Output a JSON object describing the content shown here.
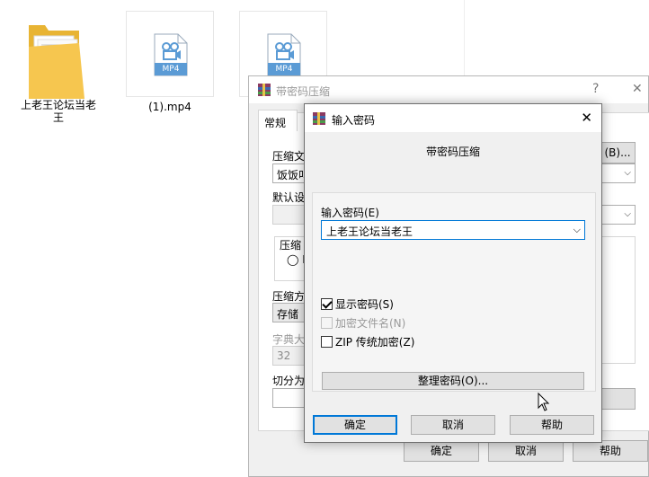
{
  "explorer": {
    "items": [
      {
        "name": "上老王论坛当老",
        "name_line2": "王",
        "type": "folder"
      },
      {
        "name": "(1).mp4",
        "type": "mp4",
        "badge": "MP4"
      },
      {
        "name": "",
        "type": "mp4",
        "badge": "MP4"
      }
    ]
  },
  "bg_window": {
    "title": "带密码压缩",
    "help_glyph": "?",
    "close_glyph": "✕",
    "tab_general": "常规",
    "archive_name_label": "压缩文",
    "archive_name_value": "饭饭叫",
    "browse_button": "(B)...",
    "default_settings_label": "默认设",
    "format_label": "压缩",
    "format_option": "◯ R",
    "method_label": "压缩方",
    "method_value": "存储",
    "dict_label": "字典大",
    "dict_value": "32",
    "split_label": "切分为",
    "ok": "确定",
    "cancel": "取消",
    "help": "帮助"
  },
  "dialog": {
    "title": "输入密码",
    "close_glyph": "✕",
    "subtitle": "带密码压缩",
    "password_label": "输入密码(E)",
    "password_value": "上老王论坛当老王",
    "show_password": {
      "label": "显示密码(S)",
      "checked": true,
      "enabled": true
    },
    "encrypt_filenames": {
      "label": "加密文件名(N)",
      "checked": false,
      "enabled": false
    },
    "zip_legacy": {
      "label": "ZIP 传统加密(Z)",
      "checked": false,
      "enabled": true
    },
    "organize_button": "整理密码(O)...",
    "ok": "确定",
    "cancel": "取消",
    "help": "帮助"
  },
  "colors": {
    "accent": "#0078d7",
    "folder": "#f6c64f",
    "mp4": "#5b9bd5"
  }
}
